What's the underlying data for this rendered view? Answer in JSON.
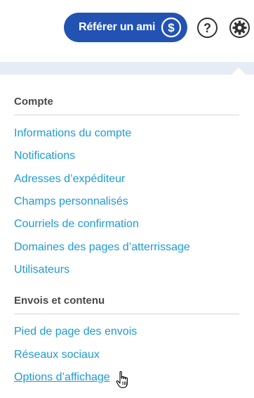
{
  "header": {
    "refer_label": "Référer un ami",
    "refer_icon": "dollar-icon",
    "help_icon": "help-icon",
    "settings_icon": "gear-icon",
    "accent_color": "#2253b3"
  },
  "menu": {
    "sections": [
      {
        "title": "Compte",
        "items": [
          "Informations du compte",
          "Notifications",
          "Adresses d’expéditeur",
          "Champs personnalisés",
          "Courriels de confirmation",
          "Domaines des pages d’atterrissage",
          "Utilisateurs"
        ]
      },
      {
        "title": "Envois et contenu",
        "items": [
          "Pied de page des envois",
          "Réseaux sociaux",
          "Options d’affichage"
        ]
      }
    ],
    "link_color": "#1c9bd6",
    "hovered_item": "Options d’affichage"
  }
}
